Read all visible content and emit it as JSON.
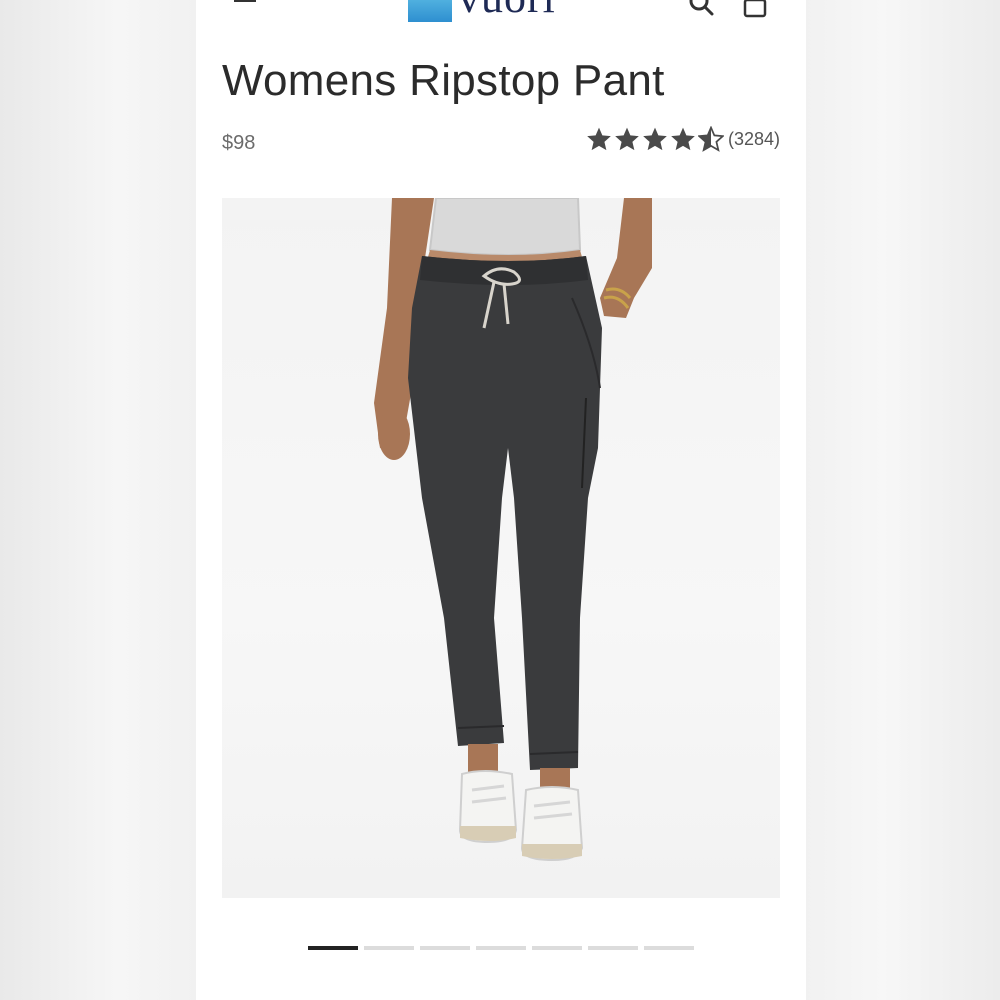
{
  "header": {
    "brand": "vuori",
    "icons": [
      "menu-icon",
      "search-icon",
      "bag-icon"
    ]
  },
  "product": {
    "title": "Womens Ripstop Pant",
    "price": "$98",
    "rating": 4.5,
    "rating_max": 5,
    "review_count": "(3284)",
    "image": "product-photo"
  },
  "gallery": {
    "total": 7,
    "active_index": 0
  },
  "colors": {
    "brand_blue": "#3aa3de",
    "text_dark": "#2b2b2b",
    "star": "#4a4a4a",
    "pager_active": "#222222",
    "pager_inactive": "#dcdcdc"
  }
}
